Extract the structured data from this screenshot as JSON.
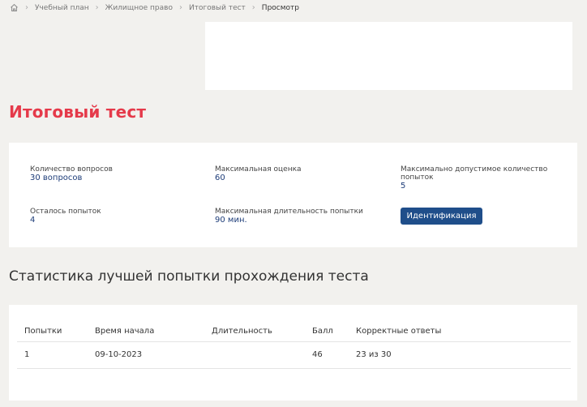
{
  "breadcrumb": {
    "home_icon": "home-icon",
    "items": [
      "Учебный план",
      "Жилищное право",
      "Итоговый тест",
      "Просмотр"
    ]
  },
  "page": {
    "title": "Итоговый тест"
  },
  "info": {
    "questions_label": "Количество вопросов",
    "questions_value": "30 вопросов",
    "max_score_label": "Максимальная оценка",
    "max_score_value": "60",
    "max_attempts_label": "Максимально допустимое количество попыток",
    "max_attempts_value": "5",
    "attempts_left_label": "Осталось попыток",
    "attempts_left_value": "4",
    "max_duration_label": "Максимальная длительность попытки",
    "max_duration_value": "90 мин.",
    "identify_button": "Идентификация"
  },
  "stats": {
    "title": "Статистика лучшей попытки прохождения теста",
    "columns": [
      "Попытки",
      "Время начала",
      "Длительность",
      "Балл",
      "Корректные ответы"
    ],
    "rows": [
      [
        "1",
        "09-10-2023",
        "",
        "46",
        "23 из 30"
      ]
    ]
  },
  "colors": {
    "accent": "#e53a4a",
    "button": "#1f4e8a",
    "value_text": "#1d3c78"
  }
}
